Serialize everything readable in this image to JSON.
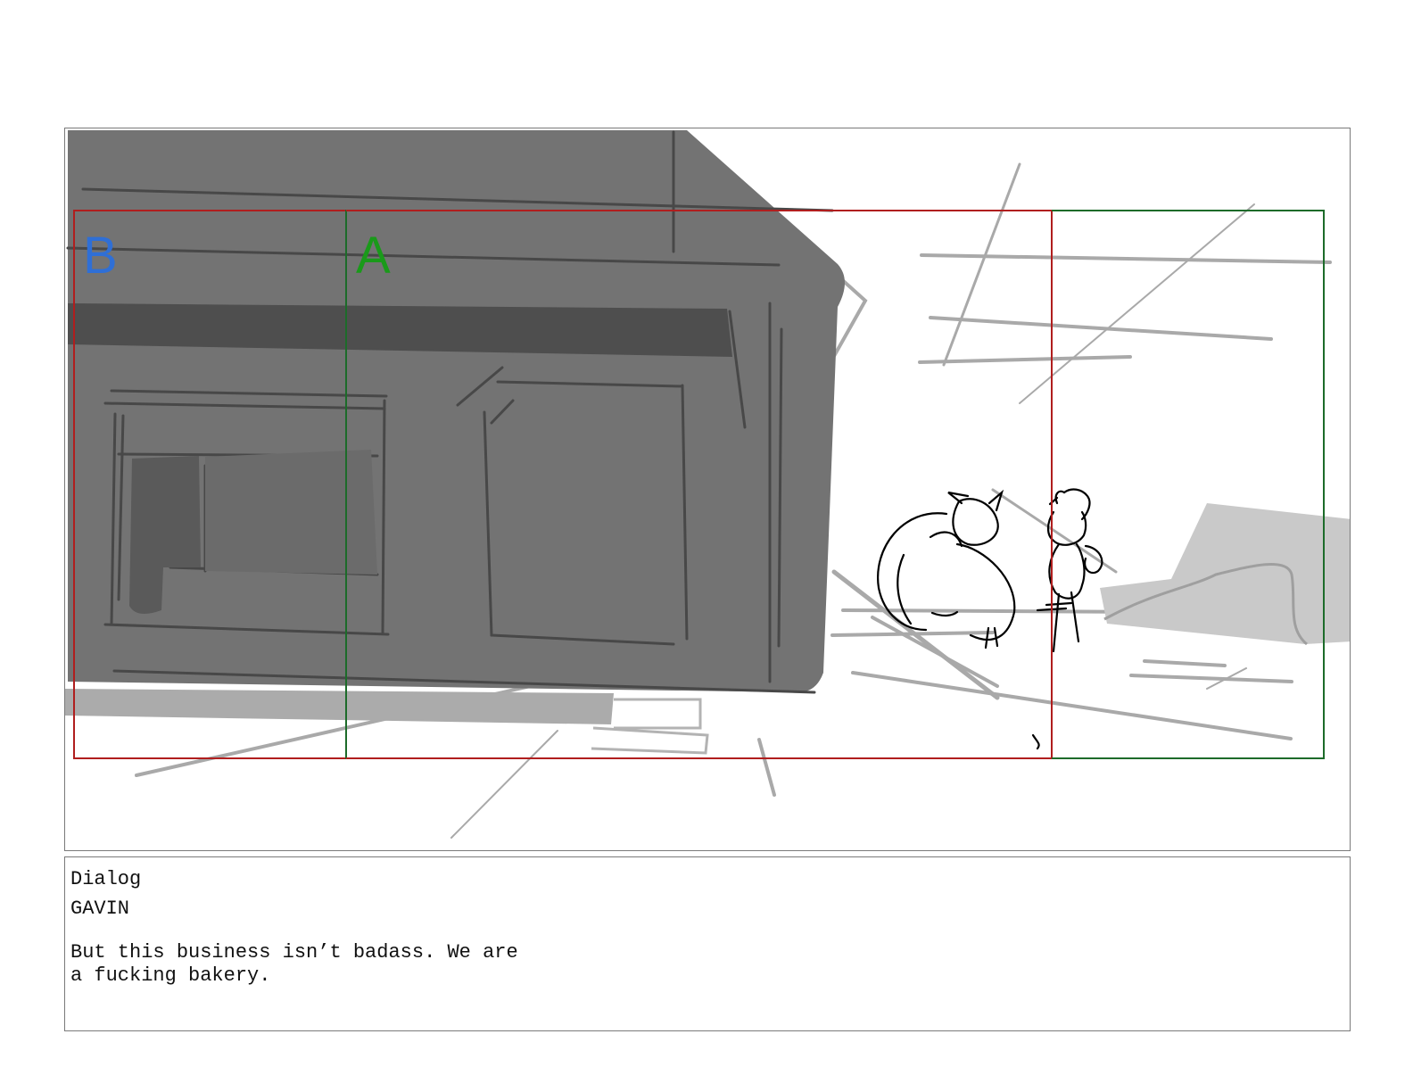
{
  "storyboard_panel": {
    "framing_labels": [
      {
        "label": "B",
        "color": "#2f6fd6"
      },
      {
        "label": "A",
        "color": "#1a9a1a"
      }
    ],
    "colors": {
      "frame_b_guide": "#b01e1e",
      "frame_a_guide": "#1d6b2a",
      "building_fill": "#737373",
      "building_dark": "#4b4b4b",
      "sketch_line": "#a7a7a7",
      "character_line": "#000000"
    }
  },
  "dialog": {
    "heading": "Dialog",
    "speaker": "GAVIN",
    "line": "But this business isn’t badass. We are a fucking bakery."
  }
}
